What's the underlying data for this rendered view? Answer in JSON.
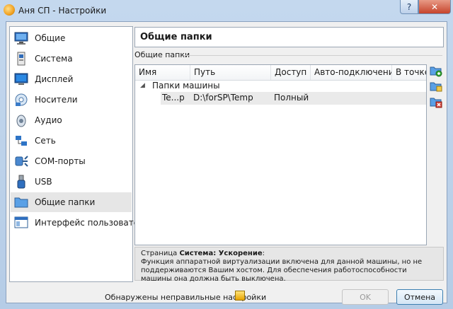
{
  "window": {
    "title": "Аня СП - Настройки",
    "help_label": "?",
    "close_label": "✕"
  },
  "sidebar": {
    "items": [
      {
        "label": "Общие",
        "icon": "monitor-icon"
      },
      {
        "label": "Система",
        "icon": "chip-icon"
      },
      {
        "label": "Дисплей",
        "icon": "display-icon"
      },
      {
        "label": "Носители",
        "icon": "disc-icon"
      },
      {
        "label": "Аудио",
        "icon": "speaker-icon"
      },
      {
        "label": "Сеть",
        "icon": "network-icon"
      },
      {
        "label": "COM-порты",
        "icon": "serial-port-icon"
      },
      {
        "label": "USB",
        "icon": "usb-icon"
      },
      {
        "label": "Общие папки",
        "icon": "folder-icon"
      },
      {
        "label": "Интерфейс пользователя",
        "icon": "ui-window-icon"
      }
    ],
    "selected_index": 8
  },
  "page": {
    "title": "Общие папки",
    "group_label": "Общие папки"
  },
  "table": {
    "columns": [
      "Имя",
      "Путь",
      "Доступ",
      "Авто-подключение",
      "В точке"
    ],
    "group": "Папки машины",
    "rows": [
      {
        "name": "Te...p",
        "path": "D:\\forSP\\Temp",
        "access": "Полный",
        "auto": "",
        "mount": ""
      }
    ]
  },
  "info": {
    "prefix": "Страница ",
    "bold": "Система: Ускорение",
    "suffix": ":",
    "text": "Функция аппаратной виртуализации включена для данной машины, но не поддерживаются Вашим хостом. Для обеспечения работоспособности машины она должна быть выключена."
  },
  "footer": {
    "message": "Обнаружены неправильные настройки",
    "ok_label": "OK",
    "cancel_label": "Отмена"
  }
}
